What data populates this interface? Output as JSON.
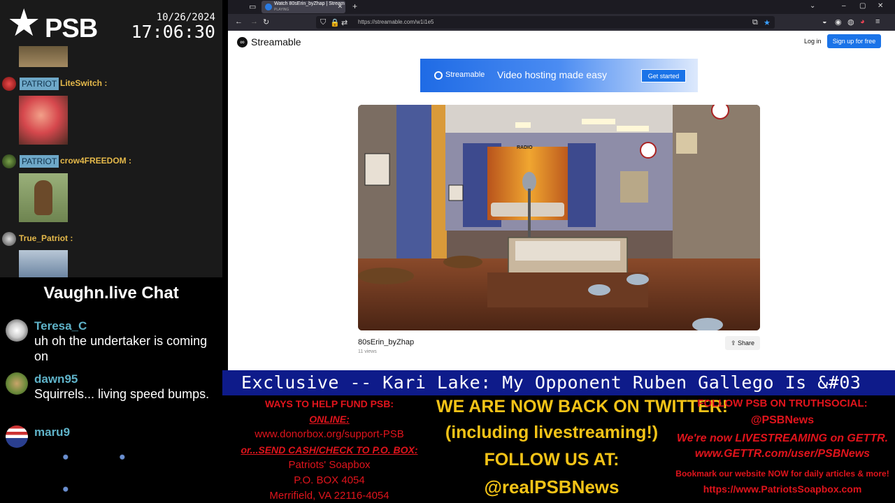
{
  "overlay": {
    "logo_text": "PSB",
    "date": "10/26/2024",
    "time": "17:06:30"
  },
  "top_chat": {
    "badge": "PATRIOT",
    "messages": [
      {
        "user": "LiteSwitch :",
        "badge": "PATRIOT"
      },
      {
        "user": "crow4FREEDOM :",
        "badge": "PATRIOT"
      },
      {
        "user": "True_Patriot :"
      }
    ]
  },
  "vaughn_chat": {
    "title": "Vaughn.live Chat",
    "messages": [
      {
        "user": "Teresa_C",
        "text": "uh oh the undertaker is coming on"
      },
      {
        "user": "dawn95",
        "text": "Squirrels... living speed bumps."
      },
      {
        "user": "maru9",
        "text": ""
      }
    ]
  },
  "browser": {
    "tab_title": "Watch 80sErin_byZhap | Stream",
    "tab_subtitle": "PLAYING",
    "url": "https://streamable.com/w1i1e5"
  },
  "streamable": {
    "logo": "Streamable",
    "login": "Log in",
    "signup": "Sign up for free",
    "banner": {
      "logo": "Streamable",
      "tagline": "Video hosting made easy",
      "cta": "Get started"
    },
    "video": {
      "title": "80sErin_byZhap",
      "views": "11 views",
      "share": "Share",
      "sign_text": "RADIO"
    }
  },
  "ticker": {
    "text": "Exclusive -- Kari Lake: My Opponent Ruben Gallego Is &#03"
  },
  "panels": {
    "left": {
      "line1": "WAYS TO HELP FUND PSB:",
      "line2": "ONLINE:",
      "line3": "www.donorbox.org/support-PSB",
      "line4": "or...SEND CASH/CHECK TO P.O. BOX:",
      "line5": "Patriots' Soapbox",
      "line6": "P.O. BOX 4054",
      "line7": "Merrifield, VA 22116-4054"
    },
    "center": {
      "line1": "WE ARE NOW BACK ON TWITTER!",
      "line2": "(including livestreaming!)",
      "line3": "FOLLOW US AT:",
      "line4": "@realPSBNews"
    },
    "right": {
      "line1": "FOLLOW PSB ON TRUTHSOCIAL:",
      "line2": "@PSBNews",
      "line3": "We're now LIVESTREAMING on GETTR.",
      "line4": "www.GETTR.com/user/PSBNews",
      "line5": "Bookmark our website NOW for daily articles & more!",
      "line6": "https://www.PatriotsSoapbox.com"
    }
  },
  "colors": {
    "ticker_bg": "#0e1b8a",
    "panel_red": "#e0141c",
    "panel_yellow": "#f3c317",
    "chat_name": "#5fb3c9",
    "badge_bg": "#6ea8c8",
    "accent_blue": "#1a73e8"
  }
}
